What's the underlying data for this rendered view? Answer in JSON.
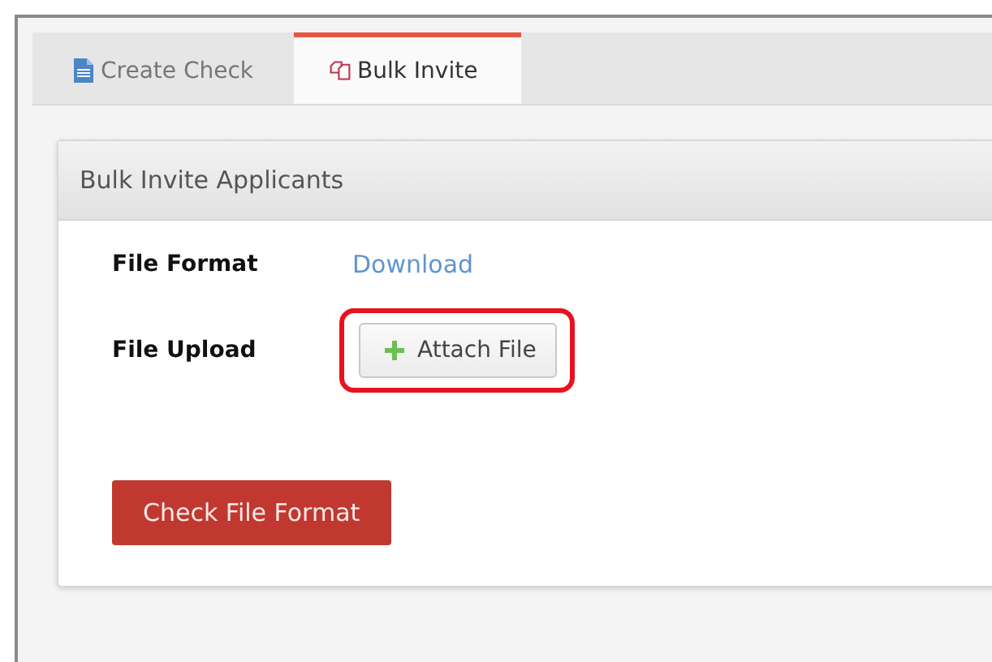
{
  "tabs": [
    {
      "label": "Create Check",
      "kind": "document",
      "selected": false
    },
    {
      "label": "Bulk Invite",
      "kind": "copies",
      "selected": true
    }
  ],
  "panel": {
    "title": "Bulk Invite Applicants",
    "rows": [
      {
        "label": "File Format",
        "kind": "link",
        "value": "Download"
      },
      {
        "label": "File Upload",
        "kind": "button",
        "value": "Attach File",
        "highlighted": true
      }
    ],
    "submit": "Check File Format"
  }
}
